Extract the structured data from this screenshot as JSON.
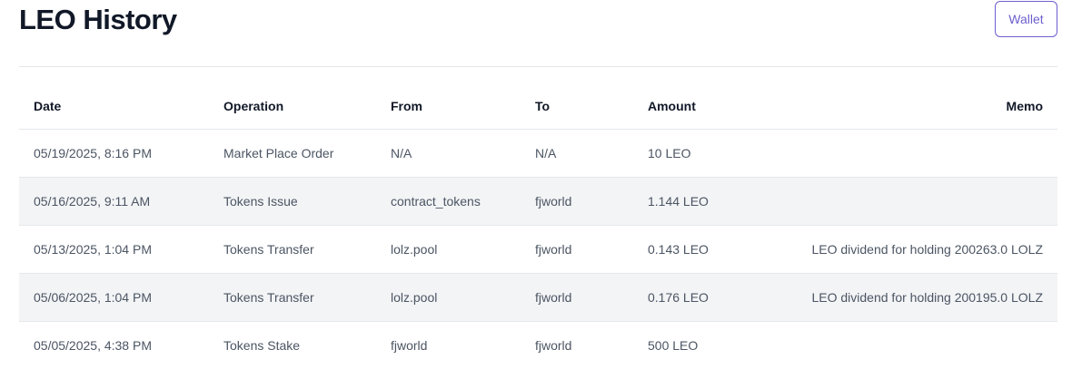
{
  "header": {
    "title": "LEO History",
    "wallet_label": "Wallet"
  },
  "table": {
    "columns": {
      "date": "Date",
      "operation": "Operation",
      "from": "From",
      "to": "To",
      "amount": "Amount",
      "memo": "Memo"
    },
    "rows": [
      {
        "date": "05/19/2025, 8:16 PM",
        "operation": "Market Place Order",
        "from": "N/A",
        "to": "N/A",
        "amount": "10 LEO",
        "memo": ""
      },
      {
        "date": "05/16/2025, 9:11 AM",
        "operation": "Tokens Issue",
        "from": "contract_tokens",
        "to": "fjworld",
        "amount": "1.144 LEO",
        "memo": ""
      },
      {
        "date": "05/13/2025, 1:04 PM",
        "operation": "Tokens Transfer",
        "from": "lolz.pool",
        "to": "fjworld",
        "amount": "0.143 LEO",
        "memo": "LEO dividend for holding 200263.0 LOLZ"
      },
      {
        "date": "05/06/2025, 1:04 PM",
        "operation": "Tokens Transfer",
        "from": "lolz.pool",
        "to": "fjworld",
        "amount": "0.176 LEO",
        "memo": "LEO dividend for holding 200195.0 LOLZ"
      },
      {
        "date": "05/05/2025, 4:38 PM",
        "operation": "Tokens Stake",
        "from": "fjworld",
        "to": "fjworld",
        "amount": "500 LEO",
        "memo": ""
      }
    ]
  },
  "colors": {
    "accent": "#6d5fcf",
    "row_alt": "#f3f4f6",
    "border": "#e5e7eb"
  }
}
